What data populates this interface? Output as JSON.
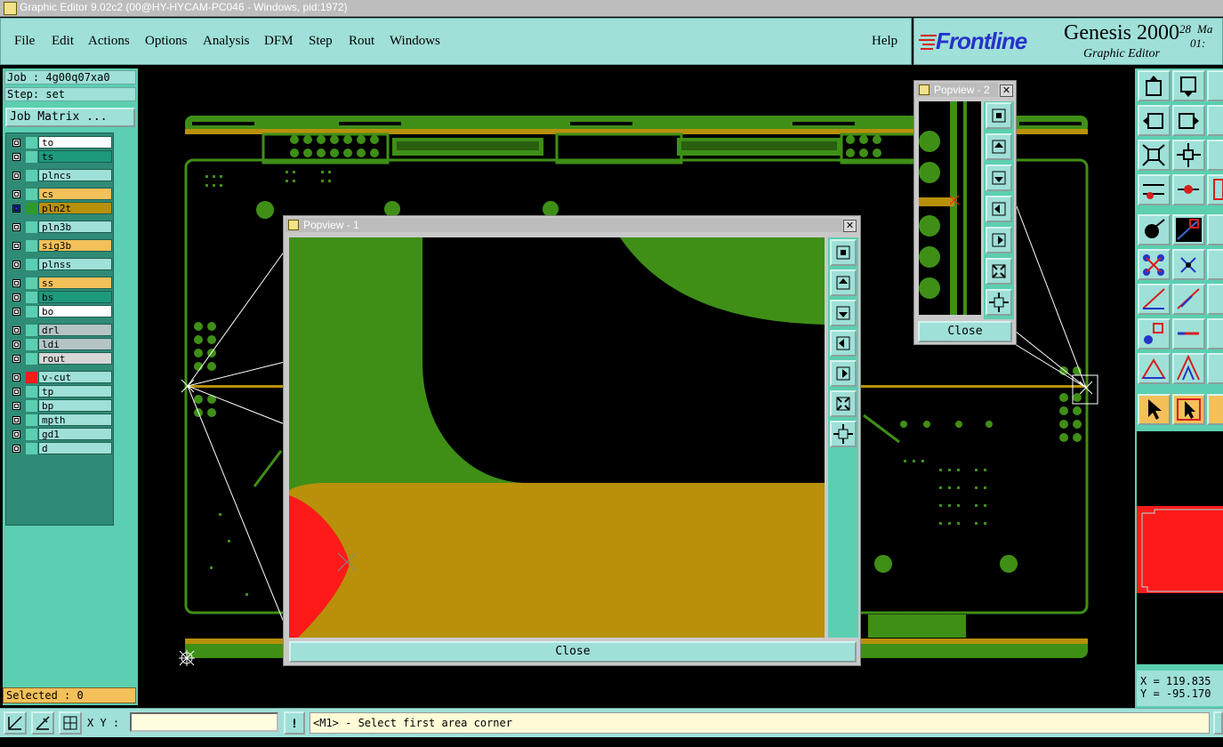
{
  "window_title": "Graphic Editor 9.02c2 (00@HY-HYCAM-PC046 - Windows, pid:1972)",
  "menu": {
    "items": [
      "File",
      "Edit",
      "Actions",
      "Options",
      "Analysis",
      "DFM",
      "Step",
      "Rout",
      "Windows"
    ],
    "help": "Help"
  },
  "brand": {
    "logo": "Frontline",
    "product": "Genesis 2000",
    "subtitle": "Graphic Editor",
    "date_partial": "28",
    "month_partial": "Ma",
    "time_partial": "01:"
  },
  "left": {
    "job": "Job : 4g00q07xa0",
    "step": "Step: set",
    "job_matrix_label": "Job Matrix ...",
    "layers": [
      {
        "name": "to",
        "color": "#ffffff",
        "swatch": "#5ccfb0",
        "checked": false
      },
      {
        "name": "ts",
        "color": "#1d9a7a",
        "swatch": "#5ccfb0",
        "checked": false
      },
      {
        "name": "plncs",
        "color": "#9fe0d8",
        "swatch": "#5ccfb0",
        "checked": false
      },
      {
        "name": "cs",
        "color": "#f3c05a",
        "swatch": "#5ccfb0",
        "checked": false
      },
      {
        "name": "pln2t",
        "color": "#b8900a",
        "swatch": "#2e9a2e",
        "checked": true
      },
      {
        "name": "pln3b",
        "color": "#9fe0d8",
        "swatch": "#5ccfb0",
        "checked": false
      },
      {
        "name": "sig3b",
        "color": "#f3c05a",
        "swatch": "#5ccfb0",
        "checked": false
      },
      {
        "name": "plnss",
        "color": "#9fe0d8",
        "swatch": "#5ccfb0",
        "checked": false
      },
      {
        "name": "ss",
        "color": "#f3c05a",
        "swatch": "#5ccfb0",
        "checked": false
      },
      {
        "name": "bs",
        "color": "#1d9a7a",
        "swatch": "#5ccfb0",
        "checked": false
      },
      {
        "name": "bo",
        "color": "#ffffff",
        "swatch": "#5ccfb0",
        "checked": false
      },
      {
        "name": "drl",
        "color": "#b4c4c4",
        "swatch": "#5ccfb0",
        "checked": false
      },
      {
        "name": "ldi",
        "color": "#b4c4c4",
        "swatch": "#5ccfb0",
        "checked": false
      },
      {
        "name": "rout",
        "color": "#d6d6d6",
        "swatch": "#5ccfb0",
        "checked": false
      },
      {
        "name": "v-cut",
        "color": "#9fe0d8",
        "swatch": "#ff1a1a",
        "checked": false
      },
      {
        "name": "tp",
        "color": "#9fe0d8",
        "swatch": "#5ccfb0",
        "checked": false
      },
      {
        "name": "bp",
        "color": "#9fe0d8",
        "swatch": "#5ccfb0",
        "checked": false
      },
      {
        "name": "mpth",
        "color": "#9fe0d8",
        "swatch": "#5ccfb0",
        "checked": false
      },
      {
        "name": "gd1",
        "color": "#9fe0d8",
        "swatch": "#5ccfb0",
        "checked": false
      },
      {
        "name": "d",
        "color": "#9fe0d8",
        "swatch": "#5ccfb0",
        "checked": false
      }
    ],
    "selected": "Selected : 0"
  },
  "popview1": {
    "title": "Popview - 1",
    "close_label": "Close"
  },
  "popview2": {
    "title": "Popview - 2",
    "close_label": "Close"
  },
  "bottom": {
    "xy_label": "X Y :",
    "xy_value": "",
    "bang": "!",
    "prompt": "<M1> - Select first area corner"
  },
  "coords": {
    "x": "X = 119.835",
    "y": "Y = -95.170"
  },
  "colors": {
    "teal": "#9fe0d8",
    "panel": "#5ccfb0",
    "copper_green": "#3f8f17",
    "plane_gold": "#b8900a",
    "vcut_red": "#ff1a1a"
  }
}
